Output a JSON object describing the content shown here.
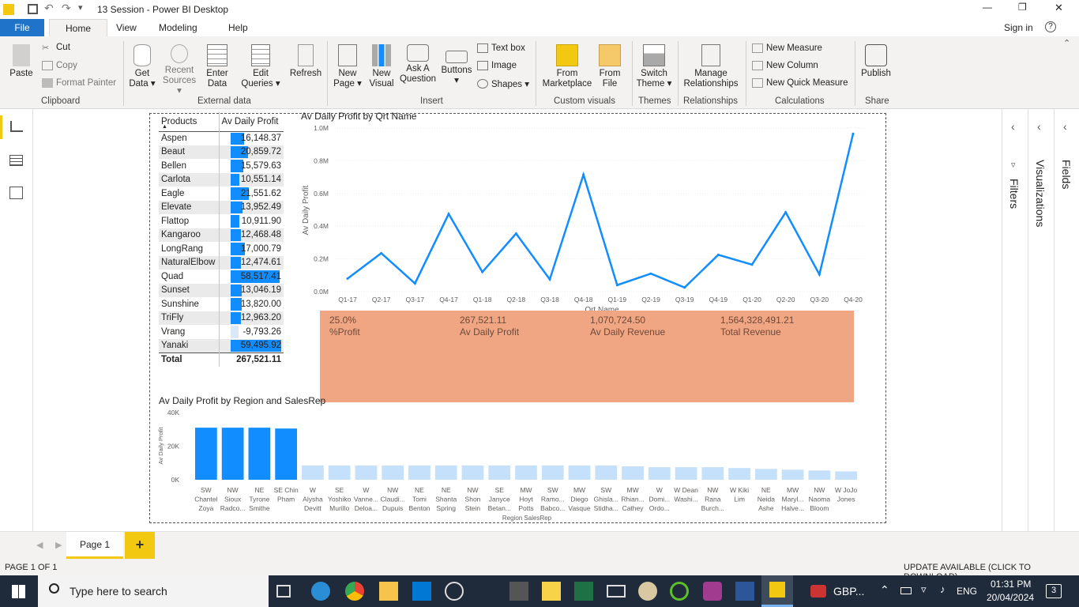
{
  "window": {
    "title": "13 Session - Power BI Desktop",
    "minimize": "—",
    "restore": "❐",
    "close": "✕"
  },
  "menu": {
    "file": "File",
    "tabs": [
      "Home",
      "View",
      "Modeling",
      "Help"
    ],
    "sign_in": "Sign in",
    "help": "?"
  },
  "ribbon": {
    "clipboard": {
      "paste": "Paste",
      "cut": "Cut",
      "copy": "Copy",
      "format_painter": "Format Painter",
      "group": "Clipboard"
    },
    "external": {
      "get_data": "Get Data ▾",
      "recent_sources": "Recent Sources ▾",
      "enter_data": "Enter Data",
      "edit_queries": "Edit Queries ▾",
      "refresh": "Refresh",
      "group": "External data"
    },
    "insert": {
      "new_page": "New Page ▾",
      "new_visual": "New Visual",
      "ask_question": "Ask A Question",
      "buttons": "Buttons ▾",
      "text_box": "Text box",
      "image": "Image",
      "shapes": "Shapes ▾",
      "group": "Insert"
    },
    "custom": {
      "marketplace": "From Marketplace",
      "from_file": "From File",
      "group": "Custom visuals"
    },
    "themes": {
      "switch_theme": "Switch Theme ▾",
      "group": "Themes"
    },
    "relationships": {
      "manage": "Manage Relationships",
      "group": "Relationships"
    },
    "calculations": {
      "new_measure": "New Measure",
      "new_column": "New Column",
      "new_quick_measure": "New Quick Measure",
      "group": "Calculations"
    },
    "share": {
      "publish": "Publish",
      "group": "Share"
    }
  },
  "panes": {
    "filters": "Filters",
    "visualizations": "Visualizations",
    "fields": "Fields"
  },
  "matrix": {
    "col_products": "Products",
    "col_profit": "Av Daily Profit",
    "rows": [
      {
        "name": "Aspen",
        "value": "16,148.37",
        "v": 16148.37
      },
      {
        "name": "Beaut",
        "value": "20,859.72",
        "v": 20859.72
      },
      {
        "name": "Bellen",
        "value": "15,579.63",
        "v": 15579.63
      },
      {
        "name": "Carlota",
        "value": "10,551.14",
        "v": 10551.14
      },
      {
        "name": "Eagle",
        "value": "21,551.62",
        "v": 21551.62
      },
      {
        "name": "Elevate",
        "value": "13,952.49",
        "v": 13952.49
      },
      {
        "name": "Flattop",
        "value": "10,911.90",
        "v": 10911.9
      },
      {
        "name": "Kangaroo",
        "value": "12,468.48",
        "v": 12468.48
      },
      {
        "name": "LongRang",
        "value": "17,000.79",
        "v": 17000.79
      },
      {
        "name": "NaturalElbow",
        "value": "12,474.61",
        "v": 12474.61
      },
      {
        "name": "Quad",
        "value": "58,517.41",
        "v": 58517.41
      },
      {
        "name": "Sunset",
        "value": "13,046.19",
        "v": 13046.19
      },
      {
        "name": "Sunshine",
        "value": "13,820.00",
        "v": 13820.0
      },
      {
        "name": "TriFly",
        "value": "12,963.20",
        "v": 12963.2
      },
      {
        "name": "Vrang",
        "value": "-9,793.26",
        "v": -9793.26
      },
      {
        "name": "Yanaki",
        "value": "59,495.92",
        "v": 59495.92
      }
    ],
    "total_label": "Total",
    "total_value": "267,521.11"
  },
  "kpi": [
    {
      "value": "25.0%",
      "label": "%Profit"
    },
    {
      "value": "267,521.11",
      "label": "Av Daily Profit"
    },
    {
      "value": "1,070,724.50",
      "label": "Av Daily Revenue"
    },
    {
      "value": "1,564,328,491.21",
      "label": "Total Revenue"
    }
  ],
  "chart_data": [
    {
      "type": "line",
      "title": "Av Daily Profit by Qrt Name",
      "xlabel": "Qrt Name",
      "ylabel": "Av Daily Profit",
      "ylim": [
        0,
        1000000
      ],
      "y_ticks": [
        "0.0M",
        "0.2M",
        "0.4M",
        "0.6M",
        "0.8M",
        "1.0M"
      ],
      "color": "#118dff",
      "x": [
        "Q1-17",
        "Q2-17",
        "Q3-17",
        "Q4-17",
        "Q1-18",
        "Q2-18",
        "Q3-18",
        "Q4-18",
        "Q1-19",
        "Q2-19",
        "Q3-19",
        "Q4-19",
        "Q1-20",
        "Q2-20",
        "Q3-20",
        "Q4-20"
      ],
      "values": [
        80000,
        235000,
        50000,
        475000,
        120000,
        355000,
        75000,
        715000,
        40000,
        110000,
        25000,
        225000,
        165000,
        485000,
        105000,
        965000
      ]
    },
    {
      "type": "bar",
      "title": "Av Daily Profit by Region and SalesRep",
      "xlabel": "Region SalesRep",
      "ylabel": "Av Daily Profit",
      "ylim": [
        0,
        40000
      ],
      "y_ticks": [
        "0K",
        "20K",
        "40K"
      ],
      "color": "#118dff",
      "faded_color": "#c5e0fb",
      "categories": [
        [
          "SW",
          "Chantel",
          "Zoya"
        ],
        [
          "NW",
          "Sioux",
          "Radco..."
        ],
        [
          "NE",
          "Tyrone",
          "Smithe"
        ],
        [
          "SE Chin",
          "Pham",
          ""
        ],
        [
          "W",
          "Alysha",
          "Devitt"
        ],
        [
          "SE",
          "Yoshiko",
          "Murillo"
        ],
        [
          "W",
          "Vanne...",
          "Deloa..."
        ],
        [
          "NW",
          "Claudi...",
          "Dupuis"
        ],
        [
          "NE",
          "Tomi",
          "Benton"
        ],
        [
          "NE",
          "Shanta",
          "Spring"
        ],
        [
          "NW",
          "Shon",
          "Stein"
        ],
        [
          "SE",
          "Janyce",
          "Betan..."
        ],
        [
          "MW",
          "Hoyt",
          "Potts"
        ],
        [
          "SW",
          "Ramo...",
          "Babco..."
        ],
        [
          "MW",
          "Diego",
          "Vasque"
        ],
        [
          "SW",
          "Ghisla...",
          "Stidha..."
        ],
        [
          "MW",
          "Rhian...",
          "Cathey"
        ],
        [
          "W",
          "Domi...",
          "Ordo..."
        ],
        [
          "W Dean",
          "Washi...",
          ""
        ],
        [
          "NW",
          "Rana",
          "Burch..."
        ],
        [
          "W Kiki",
          "Lim",
          ""
        ],
        [
          "NE",
          "Neida",
          "Ashe"
        ],
        [
          "MW",
          "Maryl...",
          "Halve..."
        ],
        [
          "NW",
          "Naoma",
          "Bloom"
        ],
        [
          "W JoJo",
          "Jones",
          ""
        ]
      ],
      "values": [
        31000,
        31000,
        31000,
        30500,
        8500,
        8500,
        8500,
        8500,
        8500,
        8500,
        8500,
        8500,
        8500,
        8500,
        8500,
        8500,
        8000,
        7500,
        7500,
        7500,
        7000,
        6500,
        6000,
        5500,
        5000
      ],
      "highlighted": [
        true,
        true,
        true,
        true,
        false,
        false,
        false,
        false,
        false,
        false,
        false,
        false,
        false,
        false,
        false,
        false,
        false,
        false,
        false,
        false,
        false,
        false,
        false,
        false,
        false
      ]
    }
  ],
  "pages": {
    "page1": "Page 1",
    "add": "+"
  },
  "status": {
    "left": "PAGE 1 OF 1",
    "right": "UPDATE AVAILABLE (CLICK TO DOWNLOAD)"
  },
  "taskbar": {
    "search": "Type here to search",
    "currency": "GBP...",
    "lang": "ENG",
    "time": "01:31 PM",
    "date": "20/04/2024",
    "notif": "3"
  }
}
